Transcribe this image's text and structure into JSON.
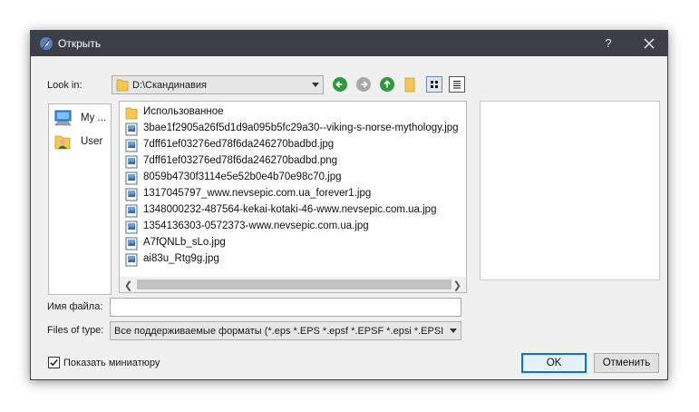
{
  "window": {
    "title": "Открыть",
    "help_label": "?"
  },
  "look_in": {
    "label": "Look in:",
    "path": "D:\\Скандинавия"
  },
  "sidebar": {
    "items": [
      {
        "label": "My ...",
        "icon": "computer-icon"
      },
      {
        "label": "User",
        "icon": "user-folder-icon"
      }
    ]
  },
  "files": [
    {
      "name": "Использованное",
      "icon": "folder-icon"
    },
    {
      "name": "3bae1f2905a26f5d1d9a095b5fc29a30--viking-s-norse-mythology.jpg",
      "icon": "image-file-icon"
    },
    {
      "name": "7dff61ef03276ed78f6da246270badbd.jpg",
      "icon": "image-file-icon"
    },
    {
      "name": "7dff61ef03276ed78f6da246270badbd.png",
      "icon": "image-file-icon"
    },
    {
      "name": "8059b4730f3114e5e52b0e4b70e98c70.jpg",
      "icon": "image-file-icon"
    },
    {
      "name": "1317045797_www.nevsepic.com.ua_forever1.jpg",
      "icon": "image-file-icon"
    },
    {
      "name": "1348000232-487564-kekai-kotaki-46-www.nevsepic.com.ua.jpg",
      "icon": "image-file-icon"
    },
    {
      "name": "1354136303-0572373-www.nevsepic.com.ua.jpg",
      "icon": "image-file-icon"
    },
    {
      "name": "A7fQNLb_sLo.jpg",
      "icon": "image-file-icon"
    },
    {
      "name": "ai83u_Rtg9g.jpg",
      "icon": "image-file-icon"
    }
  ],
  "filename": {
    "label": "Имя файла:",
    "value": ""
  },
  "filetype": {
    "label": "Files of type:",
    "value": "Все поддерживаемые форматы (*.eps *.EPS *.epsf *.EPSF *.epsi *.EPSI"
  },
  "thumbnail": {
    "label": "Показать миниатюру",
    "checked": true
  },
  "buttons": {
    "ok": "OK",
    "cancel": "Отменить"
  },
  "colors": {
    "titlebar": "#3c3f47",
    "nav_green": "#2e9b3a",
    "nav_disabled": "#a8a8a8",
    "default_button_border": "#0078d7",
    "folder_yellow": "#f5c851"
  }
}
